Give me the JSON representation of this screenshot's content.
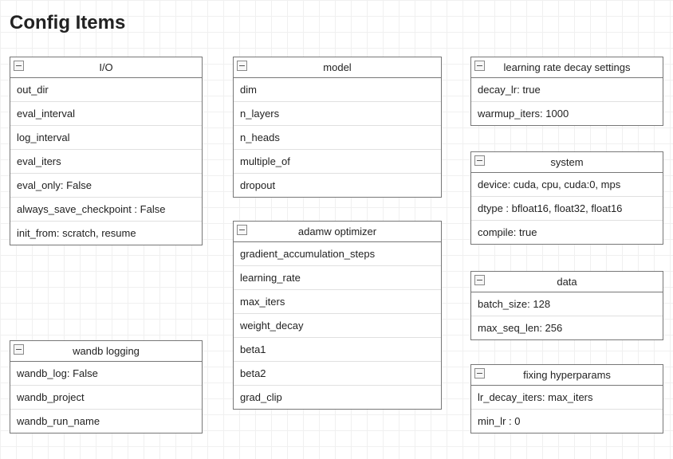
{
  "title": "Config Items",
  "panels": {
    "io": {
      "title": "I/O",
      "rows": [
        "out_dir",
        "eval_interval",
        "log_interval",
        "eval_iters",
        "eval_only: False",
        "always_save_checkpoint : False",
        "init_from: scratch, resume"
      ]
    },
    "wandb": {
      "title": "wandb logging",
      "rows": [
        "wandb_log: False",
        "wandb_project",
        "wandb_run_name"
      ]
    },
    "model": {
      "title": "model",
      "rows": [
        "dim",
        "n_layers",
        "n_heads",
        "multiple_of",
        "dropout"
      ]
    },
    "adamw": {
      "title": "adamw optimizer",
      "rows": [
        "gradient_accumulation_steps",
        "learning_rate",
        "max_iters",
        "weight_decay",
        "beta1",
        "beta2",
        "grad_clip"
      ]
    },
    "lr_decay": {
      "title": "learning rate decay settings",
      "rows": [
        "decay_lr: true",
        "warmup_iters: 1000"
      ]
    },
    "system": {
      "title": "system",
      "rows": [
        "device: cuda, cpu, cuda:0, mps",
        "dtype : bfloat16, float32, float16",
        "compile: true"
      ]
    },
    "data_panel": {
      "title": "data",
      "rows": [
        "batch_size: 128",
        "max_seq_len: 256"
      ]
    },
    "fixing": {
      "title": "fixing hyperparams",
      "rows": [
        "lr_decay_iters: max_iters",
        "min_lr : 0"
      ]
    }
  }
}
